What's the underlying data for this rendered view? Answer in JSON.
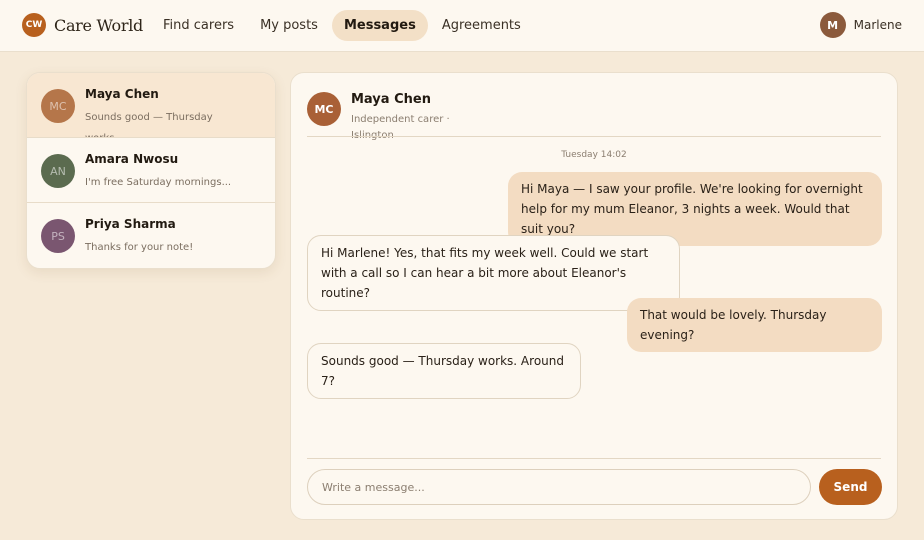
{
  "brand": {
    "logo_text": "CW",
    "name": "Care World"
  },
  "nav": {
    "items": [
      {
        "label": "Find carers"
      },
      {
        "label": "My posts"
      },
      {
        "label": "Messages",
        "active": true
      },
      {
        "label": "Agreements"
      }
    ]
  },
  "user": {
    "initial": "M",
    "name": "Marlene"
  },
  "conversations": [
    {
      "initials": "MC",
      "name": "Maya Chen",
      "preview": "Sounds good — Thursday works.",
      "avatar_color": "#b5764a",
      "active": true
    },
    {
      "initials": "AN",
      "name": "Amara Nwosu",
      "preview": "I'm free Saturday mornings...",
      "avatar_color": "#5b6b4f"
    },
    {
      "initials": "PS",
      "name": "Priya Sharma",
      "preview": "Thanks for your note!",
      "avatar_color": "#7a5670"
    }
  ],
  "chat": {
    "initials": "MC",
    "name": "Maya Chen",
    "subtitle": "Independent carer · Islington",
    "timestamp": "Tuesday 14:02",
    "messages": [
      {
        "direction": "out",
        "text": "Hi Maya — I saw your profile. We're looking for overnight help for my mum Eleanor, 3 nights a week. Would that suit you?"
      },
      {
        "direction": "in",
        "text": "Hi Marlene! Yes, that fits my week well. Could we start with a call so I can hear a bit more about Eleanor's routine?"
      },
      {
        "direction": "out",
        "text": "That would be lovely. Thursday evening?"
      },
      {
        "direction": "in",
        "text": "Sounds good — Thursday works. Around 7?"
      }
    ],
    "composer": {
      "placeholder": "Write a message...",
      "value": ""
    },
    "send_label": "Send"
  },
  "colors": {
    "accent": "#b8601e",
    "page_bg": "#f6ead8",
    "card_bg": "#fdf8f0",
    "outgoing_bubble": "#f3dcc2",
    "active_nav": "#f3e0c7"
  }
}
